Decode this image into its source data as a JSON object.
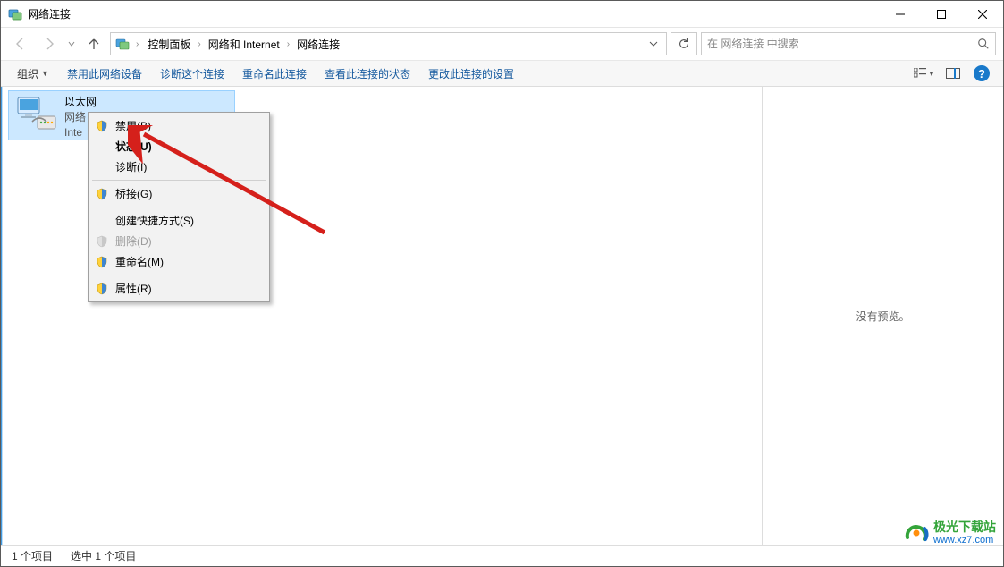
{
  "window": {
    "title": "网络连接"
  },
  "breadcrumb": {
    "a": "控制面板",
    "b": "网络和 Internet",
    "c": "网络连接"
  },
  "search": {
    "placeholder": "在 网络连接 中搜索"
  },
  "cmdbar": {
    "organize": "组织",
    "disable": "禁用此网络设备",
    "diagnose": "诊断这个连接",
    "rename": "重命名此连接",
    "status": "查看此连接的状态",
    "settings": "更改此连接的设置"
  },
  "connection": {
    "name": "以太网",
    "line2": "网络",
    "line3": "Inte"
  },
  "context_menu": {
    "disable": "禁用(B)",
    "status": "状态(U)",
    "diagnose": "诊断(I)",
    "bridge": "桥接(G)",
    "shortcut": "创建快捷方式(S)",
    "delete": "删除(D)",
    "rename": "重命名(M)",
    "properties": "属性(R)"
  },
  "preview": {
    "empty": "没有预览。"
  },
  "status": {
    "count": "1 个项目",
    "selected": "选中 1 个项目"
  },
  "watermark": {
    "cn": "极光下载站",
    "url": "www.xz7.com"
  }
}
